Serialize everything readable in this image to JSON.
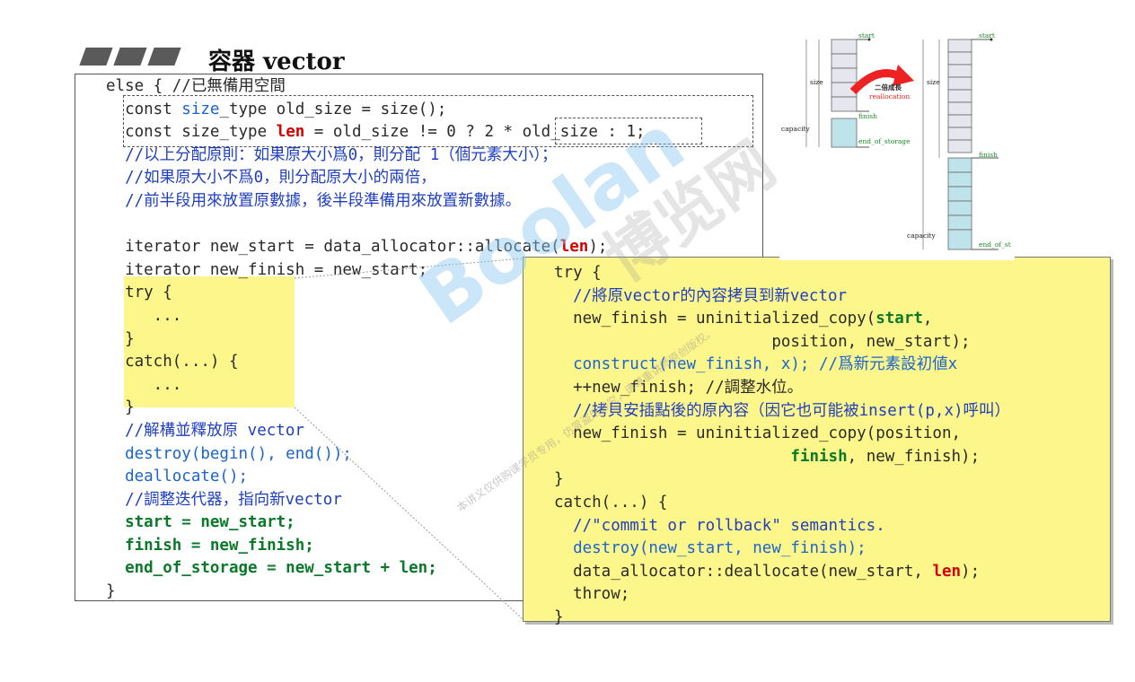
{
  "slide": {
    "title": "容器 vector"
  },
  "main_code": [
    "else { //已無備用空間",
    "  const size_type old_size = size();",
    "  const size_type len = old_size != 0 ? 2 * old_size : 1;",
    "  //以上分配原則：如果原大小爲0，則分配 1（個元素大小）；",
    "  //如果原大小不爲0，則分配原大小的兩倍，",
    "  //前半段用來放置原數據，後半段準備用來放置新數據。",
    "",
    "  iterator new_start = data_allocator::allocate(len);",
    "  iterator new_finish = new_start;",
    "  try {",
    "     ...",
    "  }",
    "  catch(...) {",
    "     ...",
    "  }",
    "  //解構並釋放原 vector",
    "  destroy(begin(), end());",
    "  deallocate();",
    "  //調整迭代器，指向新vector",
    "  start = new_start;",
    "  finish = new_finish;",
    "  end_of_storage = new_start + len;",
    "}"
  ],
  "popup_code": [
    "try {",
    "  //將原vector的內容拷貝到新vector",
    "  new_finish = uninitialized_copy(start,",
    "                       position, new_start);",
    "  construct(new_finish, x); //爲新元素設初値x",
    "  ++new_finish; //調整水位。",
    "  //拷貝安插點後的原內容（因它也可能被insert(p,x)呼叫）",
    "  new_finish = uninitialized_copy(position,",
    "                         finish, new_finish);",
    "}",
    "catch(...) {",
    "  //\"commit or rollback\" semantics.",
    "  destroy(new_start, new_finish);",
    "  data_allocator::deallocate(new_start, len);",
    "  throw;",
    "}"
  ],
  "diagram": {
    "left_labels": {
      "start": "start",
      "size": "size",
      "finish": "finish",
      "capacity": "capacity",
      "end": "end_of_storage"
    },
    "arrow_label": "二倍成長",
    "arrow_sub": "reallocation",
    "right_labels": {
      "start": "start",
      "size": "size",
      "finish": "finish",
      "capacity": "capacity",
      "end": "end_of_st"
    }
  },
  "watermark": {
    "brand": "Boolan",
    "cn": "博览网",
    "note": "本讲义仅供购课学员专用，仿冒盗用必究，请尊重讲师原创版权。"
  },
  "colors": {
    "highlight_yellow": "#fdf68a",
    "keyword_red": "#d40000",
    "keyword_green": "#0a7a2a",
    "func_blue": "#1a64d0",
    "comment_blue": "#1f3fbf"
  }
}
